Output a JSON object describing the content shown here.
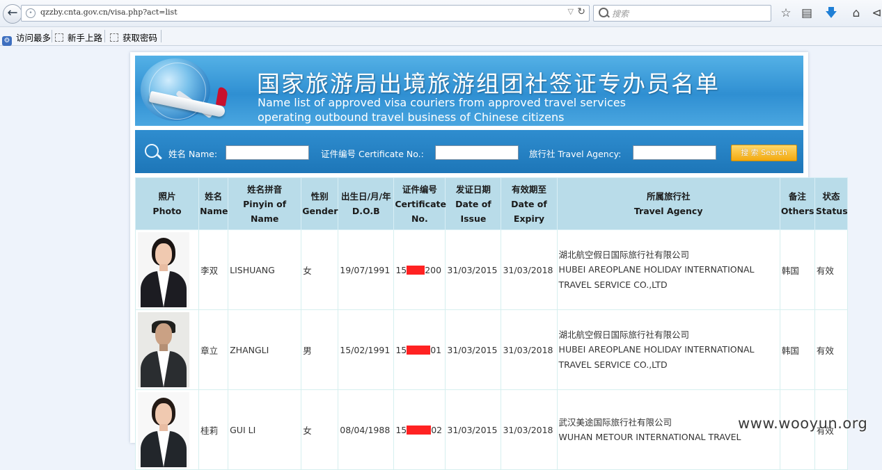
{
  "browser": {
    "url": "qzzby.cnta.gov.cn/visa.php?act=list",
    "search_placeholder": "搜索",
    "bookmarks": [
      "访问最多",
      "新手上路",
      "获取密码"
    ]
  },
  "banner": {
    "title": "国家旅游局出境旅游组团社签证专办员名单",
    "subtitle_line1": "Name list of approved visa couriers from approved travel services",
    "subtitle_line2": "operating outbound travel business of Chinese citizens"
  },
  "search": {
    "name_label": "姓名 Name:",
    "cert_label": "证件编号 Certificate No.:",
    "agency_label": "旅行社 Travel Agency:",
    "button_label": "搜 索 Search"
  },
  "table": {
    "headers": [
      {
        "cn": "照片",
        "en": "Photo"
      },
      {
        "cn": "姓名",
        "en": "Name"
      },
      {
        "cn": "姓名拼音",
        "en": "Pinyin of Name"
      },
      {
        "cn": "性别",
        "en": "Gender"
      },
      {
        "cn": "出生日/月/年",
        "en": "D.O.B"
      },
      {
        "cn": "证件编号",
        "en": "Certificate No."
      },
      {
        "cn": "发证日期",
        "en": "Date of Issue"
      },
      {
        "cn": "有效期至",
        "en": "Date of Expiry"
      },
      {
        "cn": "所属旅行社",
        "en": "Travel Agency"
      },
      {
        "cn": "备注",
        "en": "Others"
      },
      {
        "cn": "状态",
        "en": "Status"
      }
    ],
    "rows": [
      {
        "name": "李双",
        "pinyin": "LISHUANG",
        "gender": "女",
        "dob": "19/07/1991",
        "cert_prefix": "15",
        "cert_suffix": "200",
        "issue": "31/03/2015",
        "expiry": "31/03/2018",
        "agency_cn": "湖北航空假日国际旅行社有限公司",
        "agency_en_1": "HUBEI AREOPLANE HOLIDAY INTERNATIONAL",
        "agency_en_2": "TRAVEL SERVICE CO.,LTD",
        "others": "韩国",
        "status": "有效"
      },
      {
        "name": "章立",
        "pinyin": "ZHANGLI",
        "gender": "男",
        "dob": "15/02/1991",
        "cert_prefix": "15",
        "cert_suffix": "01",
        "issue": "31/03/2015",
        "expiry": "31/03/2018",
        "agency_cn": "湖北航空假日国际旅行社有限公司",
        "agency_en_1": "HUBEI AREOPLANE HOLIDAY INTERNATIONAL",
        "agency_en_2": "TRAVEL SERVICE CO.,LTD",
        "others": "韩国",
        "status": "有效"
      },
      {
        "name": "桂莉",
        "pinyin": "GUI LI",
        "gender": "女",
        "dob": "08/04/1988",
        "cert_prefix": "15",
        "cert_suffix": "02",
        "issue": "31/03/2015",
        "expiry": "31/03/2018",
        "agency_cn": "武汉美途国际旅行社有限公司",
        "agency_en_1": "WUHAN METOUR INTERNATIONAL TRAVEL",
        "agency_en_2": "",
        "others": "",
        "status": "有效"
      }
    ]
  },
  "watermark": "www.wooyun.org"
}
